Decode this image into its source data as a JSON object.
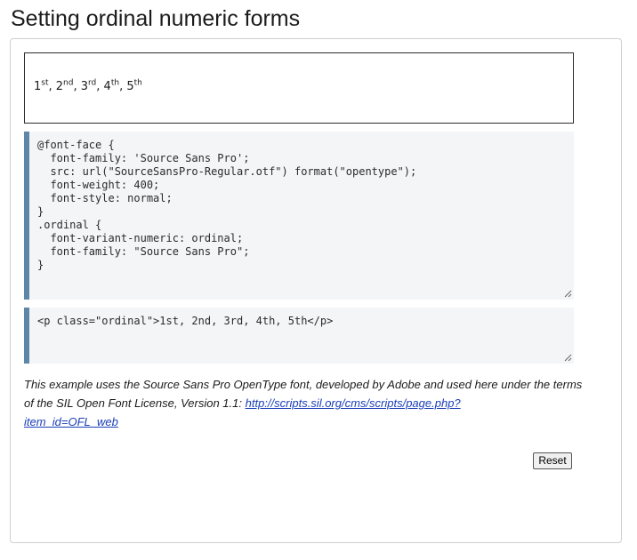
{
  "page": {
    "title": "Setting ordinal numeric forms"
  },
  "output": {
    "items": [
      {
        "number": "1",
        "suffix": "st"
      },
      {
        "number": "2",
        "suffix": "nd"
      },
      {
        "number": "3",
        "suffix": "rd"
      },
      {
        "number": "4",
        "suffix": "th"
      },
      {
        "number": "5",
        "suffix": "th"
      }
    ],
    "separator": ", "
  },
  "css_editor": {
    "code": "@font-face {\n  font-family: 'Source Sans Pro';\n  src: url(\"SourceSansPro-Regular.otf\") format(\"opentype\");\n  font-weight: 400;\n  font-style: normal;\n}\n.ordinal {\n  font-variant-numeric: ordinal;\n  font-family: \"Source Sans Pro\";\n}"
  },
  "html_editor": {
    "code": "<p class=\"ordinal\">1st, 2nd, 3rd, 4th, 5th</p>"
  },
  "description": {
    "text": "This example uses the Source Sans Pro OpenType font, developed by Adobe and used here under the terms of the SIL Open Font License, Version 1.1: ",
    "link_line1": "http://scripts.sil.org/cms/scripts/page.php?",
    "link_line2": "item_id=OFL_web"
  },
  "controls": {
    "reset_label": "Reset"
  },
  "colors": {
    "editor_background": "#f4f5f7",
    "editor_accent": "#5e86a7",
    "link": "#1a3eb8",
    "panel_border": "#cfcfcf"
  }
}
